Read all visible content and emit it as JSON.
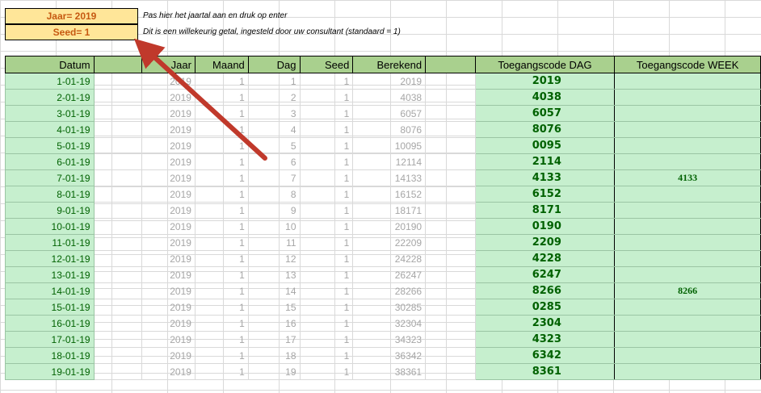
{
  "params": {
    "year_label": "Jaar= 2019",
    "seed_label": "Seed= 1",
    "year_note": "Pas hier het jaartal aan en druk op enter",
    "seed_note": "Dit is een willekeurig getal, ingesteld door uw consultant (standaard = 1)"
  },
  "headers": {
    "datum": "Datum",
    "jaar": "Jaar",
    "maand": "Maand",
    "dag": "Dag",
    "seed": "Seed",
    "berekend": "Berekend",
    "code_dag": "Toegangscode DAG",
    "code_week": "Toegangscode WEEK"
  },
  "rows": [
    {
      "datum": "1-01-19",
      "jaar": "2019",
      "maand": "1",
      "dag": "1",
      "seed": "1",
      "berekend": "2019",
      "code_dag": "2019",
      "code_week": ""
    },
    {
      "datum": "2-01-19",
      "jaar": "2019",
      "maand": "1",
      "dag": "2",
      "seed": "1",
      "berekend": "4038",
      "code_dag": "4038",
      "code_week": ""
    },
    {
      "datum": "3-01-19",
      "jaar": "2019",
      "maand": "1",
      "dag": "3",
      "seed": "1",
      "berekend": "6057",
      "code_dag": "6057",
      "code_week": ""
    },
    {
      "datum": "4-01-19",
      "jaar": "2019",
      "maand": "1",
      "dag": "4",
      "seed": "1",
      "berekend": "8076",
      "code_dag": "8076",
      "code_week": ""
    },
    {
      "datum": "5-01-19",
      "jaar": "2019",
      "maand": "1",
      "dag": "5",
      "seed": "1",
      "berekend": "10095",
      "code_dag": "0095",
      "code_week": ""
    },
    {
      "datum": "6-01-19",
      "jaar": "2019",
      "maand": "1",
      "dag": "6",
      "seed": "1",
      "berekend": "12114",
      "code_dag": "2114",
      "code_week": ""
    },
    {
      "datum": "7-01-19",
      "jaar": "2019",
      "maand": "1",
      "dag": "7",
      "seed": "1",
      "berekend": "14133",
      "code_dag": "4133",
      "code_week": "4133"
    },
    {
      "datum": "8-01-19",
      "jaar": "2019",
      "maand": "1",
      "dag": "8",
      "seed": "1",
      "berekend": "16152",
      "code_dag": "6152",
      "code_week": ""
    },
    {
      "datum": "9-01-19",
      "jaar": "2019",
      "maand": "1",
      "dag": "9",
      "seed": "1",
      "berekend": "18171",
      "code_dag": "8171",
      "code_week": ""
    },
    {
      "datum": "10-01-19",
      "jaar": "2019",
      "maand": "1",
      "dag": "10",
      "seed": "1",
      "berekend": "20190",
      "code_dag": "0190",
      "code_week": ""
    },
    {
      "datum": "11-01-19",
      "jaar": "2019",
      "maand": "1",
      "dag": "11",
      "seed": "1",
      "berekend": "22209",
      "code_dag": "2209",
      "code_week": ""
    },
    {
      "datum": "12-01-19",
      "jaar": "2019",
      "maand": "1",
      "dag": "12",
      "seed": "1",
      "berekend": "24228",
      "code_dag": "4228",
      "code_week": ""
    },
    {
      "datum": "13-01-19",
      "jaar": "2019",
      "maand": "1",
      "dag": "13",
      "seed": "1",
      "berekend": "26247",
      "code_dag": "6247",
      "code_week": ""
    },
    {
      "datum": "14-01-19",
      "jaar": "2019",
      "maand": "1",
      "dag": "14",
      "seed": "1",
      "berekend": "28266",
      "code_dag": "8266",
      "code_week": "8266"
    },
    {
      "datum": "15-01-19",
      "jaar": "2019",
      "maand": "1",
      "dag": "15",
      "seed": "1",
      "berekend": "30285",
      "code_dag": "0285",
      "code_week": ""
    },
    {
      "datum": "16-01-19",
      "jaar": "2019",
      "maand": "1",
      "dag": "16",
      "seed": "1",
      "berekend": "32304",
      "code_dag": "2304",
      "code_week": ""
    },
    {
      "datum": "17-01-19",
      "jaar": "2019",
      "maand": "1",
      "dag": "17",
      "seed": "1",
      "berekend": "34323",
      "code_dag": "4323",
      "code_week": ""
    },
    {
      "datum": "18-01-19",
      "jaar": "2019",
      "maand": "1",
      "dag": "18",
      "seed": "1",
      "berekend": "36342",
      "code_dag": "6342",
      "code_week": ""
    },
    {
      "datum": "19-01-19",
      "jaar": "2019",
      "maand": "1",
      "dag": "19",
      "seed": "1",
      "berekend": "38361",
      "code_dag": "8361",
      "code_week": ""
    }
  ],
  "colors": {
    "header_green": "#a9d08e",
    "cell_green": "#c6efce",
    "code_text": "#006100",
    "param_fill": "#ffe699",
    "param_text": "#c65911",
    "arrow": "#c0392b"
  }
}
